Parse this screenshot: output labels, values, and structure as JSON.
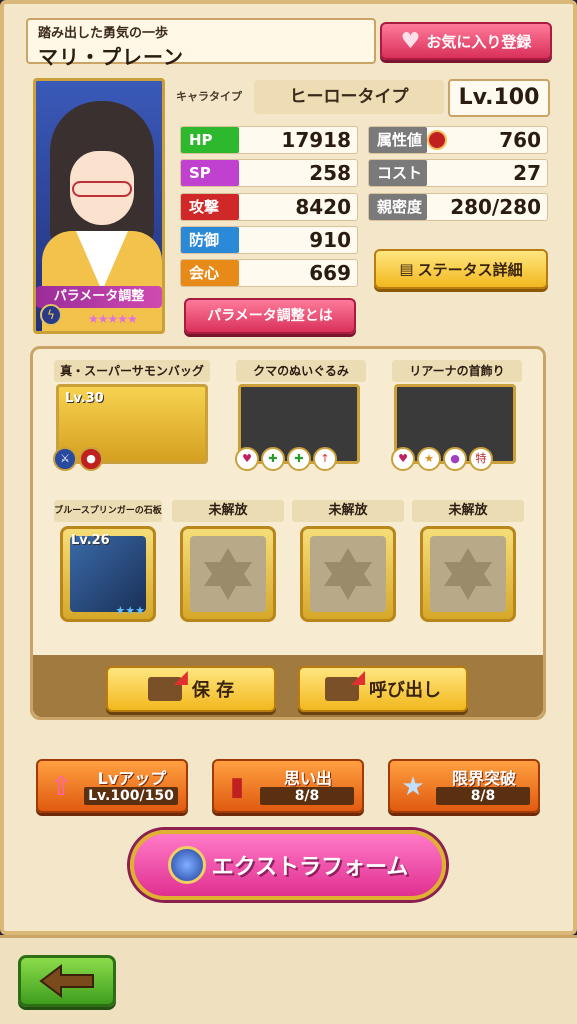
{
  "header": {
    "subtitle": "踏み出した勇気の一歩",
    "name": "マリ・プレーン",
    "favorite_label": "お気に入り登録"
  },
  "portrait": {
    "param_badge": "パラメータ調整",
    "stars": "★★★★★"
  },
  "profile": {
    "type_label": "キャラタイプ",
    "type_value": "ヒーロータイプ",
    "level": "Lv.100"
  },
  "stats_left": [
    {
      "label": "HP",
      "value": "17918",
      "color": "#2eb82e"
    },
    {
      "label": "SP",
      "value": "258",
      "color": "#c040d0"
    },
    {
      "label": "攻撃",
      "value": "8420",
      "color": "#d02828"
    },
    {
      "label": "防御",
      "value": "910",
      "color": "#2a8ad8"
    },
    {
      "label": "会心",
      "value": "669",
      "color": "#e88a18"
    }
  ],
  "stats_right": [
    {
      "label": "属性値",
      "value": "760"
    },
    {
      "label": "コスト",
      "value": "27"
    },
    {
      "label": "親密度",
      "value": "280/280"
    }
  ],
  "buttons": {
    "status_detail": "ステータス詳細",
    "param_about": "パラメータ調整とは",
    "save": "保 存",
    "recall": "呼び出し",
    "extra_form": "エクストラフォーム"
  },
  "equipment": [
    {
      "title": "真・スーパーサモンバッグ",
      "level": "Lv.30"
    },
    {
      "title": "クマのぬいぐるみ",
      "level": ""
    },
    {
      "title": "リアーナの首飾り",
      "level": ""
    }
  ],
  "stones": [
    {
      "title": "ブルースプリンガーの石板",
      "level": "Lv.26",
      "stars": "★★★"
    },
    {
      "title": "未解放"
    },
    {
      "title": "未解放"
    },
    {
      "title": "未解放"
    }
  ],
  "actions": [
    {
      "title": "Lvアップ",
      "value": "Lv.100/150"
    },
    {
      "title": "思い出",
      "value": "8/8"
    },
    {
      "title": "限界突破",
      "value": "8/8"
    }
  ]
}
